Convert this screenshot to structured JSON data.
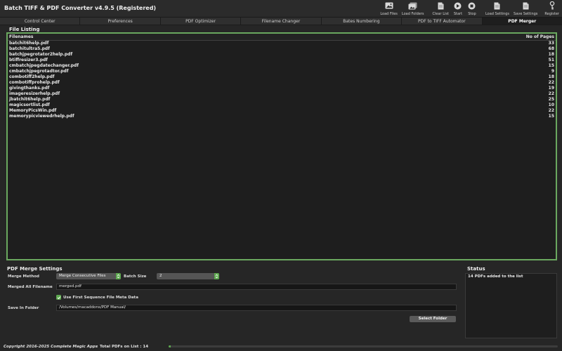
{
  "app": {
    "title": "Batch TIFF & PDF Converter v4.9.5 (Registered)"
  },
  "toolbar": [
    {
      "label": "Load Files",
      "icon": "image-icon"
    },
    {
      "label": "Load Folders",
      "icon": "images-icon"
    },
    {
      "label": "Clear List",
      "icon": "document-icon"
    },
    {
      "label": "Start",
      "icon": "play-icon"
    },
    {
      "label": "Stop",
      "icon": "stop-icon"
    },
    {
      "label": "Load Settings",
      "icon": "document-icon"
    },
    {
      "label": "Save Settings",
      "icon": "document-icon"
    },
    {
      "label": "Register",
      "icon": "key-icon"
    }
  ],
  "tabs": [
    {
      "label": "Control Center",
      "active": false
    },
    {
      "label": "Preferences",
      "active": false
    },
    {
      "label": "PDF Optimizer",
      "active": false
    },
    {
      "label": "Filename Changer",
      "active": false
    },
    {
      "label": "Bates Numbering",
      "active": false
    },
    {
      "label": "PDF to TIFF Automator",
      "active": false
    },
    {
      "label": "PDF Merger",
      "active": true
    }
  ],
  "file_listing": {
    "title": "File Listing",
    "columns": {
      "filename": "Filenames",
      "pages": "No of Pages"
    },
    "rows": [
      {
        "filename": "batchit6help.pdf",
        "pages": "33"
      },
      {
        "filename": "batchitultra5.pdf",
        "pages": "68"
      },
      {
        "filename": "batchjpegrotator2help.pdf",
        "pages": "18"
      },
      {
        "filename": "btiffresizer3.pdf",
        "pages": "51"
      },
      {
        "filename": "cmbatchjpegdatechanger.pdf",
        "pages": "15"
      },
      {
        "filename": "cmbatchjpegrotadtor.pdf",
        "pages": "9"
      },
      {
        "filename": "combotiff2help.pdf",
        "pages": "18"
      },
      {
        "filename": "combotiffprohelp.pdf",
        "pages": "22"
      },
      {
        "filename": "givingthanks.pdf",
        "pages": "19"
      },
      {
        "filename": "imageresizerhelp.pdf",
        "pages": "22"
      },
      {
        "filename": "jbatchit6help.pdf",
        "pages": "25"
      },
      {
        "filename": "magicsortlist.pdf",
        "pages": "10"
      },
      {
        "filename": "MemoryPicsWin.pdf",
        "pages": "22"
      },
      {
        "filename": "memorypicviewedrhelp.pdf",
        "pages": "15"
      }
    ]
  },
  "merge_settings": {
    "title": "PDF Merge Settings",
    "merge_method_label": "Merge Method",
    "merge_method_value": "Merge Consecutive Files",
    "batch_size_label": "Batch Size",
    "batch_size_value": "2",
    "merged_filename_label": "Merged All Filename",
    "merged_filename_value": "merged.pdf",
    "meta_checkbox_label": "Use First Sequence File Meta Data",
    "meta_checkbox_checked": true,
    "save_folder_label": "Save In Folder",
    "save_folder_value": "/Volumes/macaddons/PDF Manual/",
    "select_folder_button": "Select Folder"
  },
  "status": {
    "title": "Status",
    "message": "14 PDFs added to the list"
  },
  "footer": {
    "copyright": "Copyright 2016-2025 Complete Magic Apps",
    "total_label": "Total PDFs on List : 14",
    "progress_fraction": 0.003
  },
  "colors": {
    "accent": "#5da84f",
    "border_green": "#6aa85f",
    "background": "#262626",
    "panel": "#1e1e1e"
  }
}
